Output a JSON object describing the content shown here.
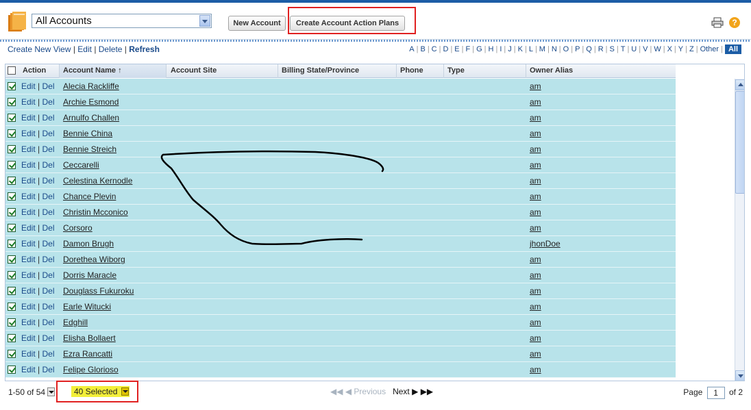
{
  "header": {
    "view_selected": "All Accounts",
    "buttons": {
      "new_account": "New Account",
      "create_plans": "Create Account Action Plans"
    },
    "help_glyph": "?"
  },
  "view_links": {
    "create": "Create New View",
    "edit": "Edit",
    "delete": "Delete",
    "refresh": "Refresh"
  },
  "alphabet": [
    "A",
    "B",
    "C",
    "D",
    "E",
    "F",
    "G",
    "H",
    "I",
    "J",
    "K",
    "L",
    "M",
    "N",
    "O",
    "P",
    "Q",
    "R",
    "S",
    "T",
    "U",
    "V",
    "W",
    "X",
    "Y",
    "Z",
    "Other"
  ],
  "alphabet_active": "All",
  "columns": {
    "action": "Action",
    "account_name": "Account Name ↑",
    "account_site": "Account Site",
    "billing_state": "Billing State/Province",
    "phone": "Phone",
    "type": "Type",
    "owner_alias": "Owner Alias"
  },
  "row_actions": {
    "edit": "Edit",
    "del": "Del"
  },
  "rows": [
    {
      "name": "Alecia Rackliffe",
      "owner": "am"
    },
    {
      "name": "Archie Esmond",
      "owner": "am"
    },
    {
      "name": "Arnulfo Challen",
      "owner": "am"
    },
    {
      "name": "Bennie China",
      "owner": "am"
    },
    {
      "name": "Bennie Streich",
      "owner": "am"
    },
    {
      "name": "Ceccarelli",
      "owner": "am"
    },
    {
      "name": "Celestina Kernodle",
      "owner": "am"
    },
    {
      "name": "Chance Plevin",
      "owner": "am"
    },
    {
      "name": "Christin Mcconico",
      "owner": "am"
    },
    {
      "name": "Corsoro",
      "owner": "am"
    },
    {
      "name": "Damon Brugh",
      "owner": "jhonDoe"
    },
    {
      "name": "Dorethea Wiborg",
      "owner": "am"
    },
    {
      "name": "Dorris Maracle",
      "owner": "am"
    },
    {
      "name": "Douglass Fukuroku",
      "owner": "am"
    },
    {
      "name": "Earle Witucki",
      "owner": "am"
    },
    {
      "name": "Edghill",
      "owner": "am"
    },
    {
      "name": "Elisha Bollaert",
      "owner": "am"
    },
    {
      "name": "Ezra Rancatti",
      "owner": "am"
    },
    {
      "name": "Felipe Glorioso",
      "owner": "am"
    }
  ],
  "footer": {
    "range": "1-50 of 54",
    "selected": "40 Selected",
    "previous": "Previous",
    "next": "Next",
    "page_label": "Page",
    "page_value": "1",
    "page_total": "of 2"
  },
  "colors": {
    "row_bg": "#b8e3ea",
    "accent": "#1c5da6",
    "highlight": "#f3ef3a",
    "annotation": "#e02020"
  }
}
